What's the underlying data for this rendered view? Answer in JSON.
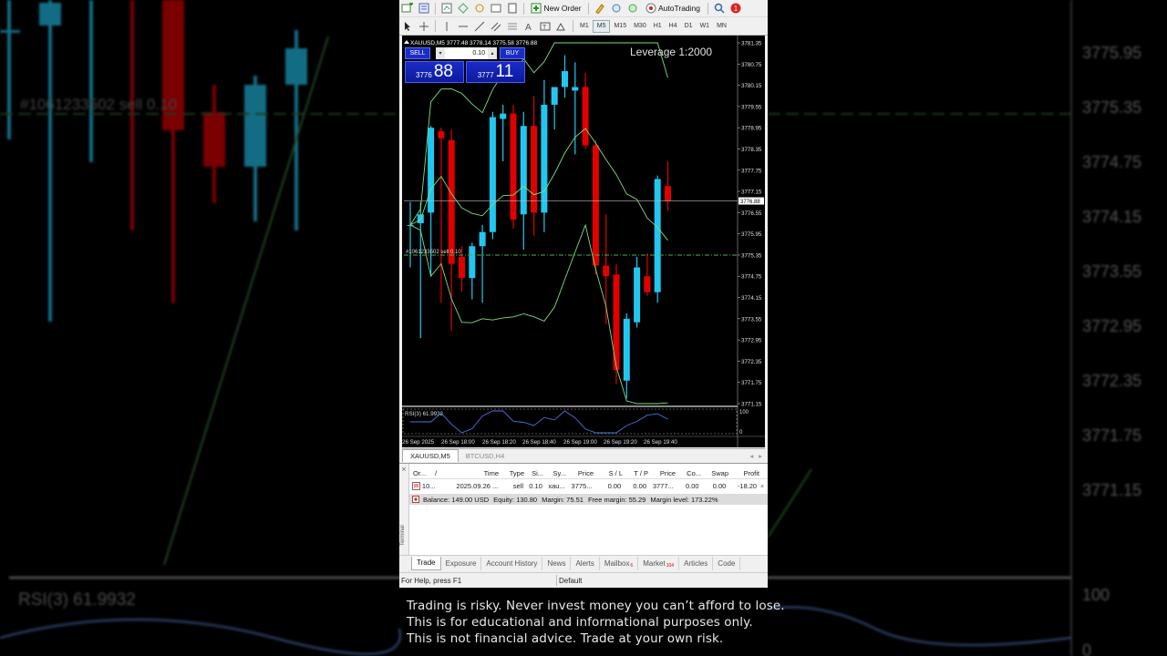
{
  "toolbar": {
    "new_order": "New Order",
    "autotrading": "AutoTrading",
    "notification_count": "1",
    "timeframes": [
      "M1",
      "M5",
      "M15",
      "M30",
      "H1",
      "H4",
      "D1",
      "W1",
      "MN"
    ],
    "active_timeframe": "M5"
  },
  "chart": {
    "header": "XAUUSD,M5  3777.48 3778.14 3775.58 3776.88",
    "leverage": "Leverage 1:2000",
    "position_label": "#1061233502 sell 0.10",
    "current_price_tag": "3776.88",
    "price_axis": [
      "3781.35",
      "3780.75",
      "3780.15",
      "3779.55",
      "3778.95",
      "3778.35",
      "3777.75",
      "3777.15",
      "3776.55",
      "3775.95",
      "3775.35",
      "3774.75",
      "3774.15",
      "3773.55",
      "3772.95",
      "3772.35",
      "3771.75",
      "3771.15"
    ],
    "time_axis": [
      "26 Sep 2025",
      "26 Sep 18:00",
      "26 Sep 18:20",
      "26 Sep 18:40",
      "26 Sep 19:00",
      "26 Sep 19:20",
      "26 Sep 19:40"
    ],
    "rsi_label": "RSI(3) 61.9932",
    "rsi_axis_top": "100",
    "rsi_axis_bottom": "0",
    "colors": {
      "bull": "#22c7f0",
      "bear": "#e00000",
      "bands": "#7fdf7f",
      "rsi": "#4a73d8",
      "sell_line": "#4caf50"
    }
  },
  "one_click": {
    "sell_label": "SELL",
    "buy_label": "BUY",
    "lot": "0.10",
    "sell_price_small": "3776",
    "sell_price_big": "88",
    "buy_price_small": "3777",
    "buy_price_big": "11"
  },
  "chart_tabs": [
    "XAUUSD,M5",
    "BTCUSD,H4"
  ],
  "terminal": {
    "label": "Terminal",
    "columns": [
      "Or...",
      "/",
      "Time",
      "Type",
      "Si...",
      "Sy...",
      "Price",
      "S / L",
      "T / P",
      "Price",
      "Co...",
      "Swap",
      "Profit"
    ],
    "row": {
      "order": "10...",
      "time": "2025.09.26 ...",
      "type": "sell",
      "size": "0.10",
      "symbol": "xau...",
      "price": "3775...",
      "sl": "0.00",
      "tp": "0.00",
      "cur_price": "3777...",
      "commission": "0.00",
      "swap": "0.00",
      "profit": "-18.20"
    },
    "balance": {
      "balance": "Balance: 149.00 USD",
      "equity": "Equity: 130.80",
      "margin": "Margin: 75.51",
      "free_margin": "Free margin: 55.29",
      "margin_level": "Margin level: 173.22%"
    },
    "tabs": [
      "Trade",
      "Exposure",
      "Account History",
      "News",
      "Alerts",
      "Mailbox",
      "Market",
      "Articles",
      "Code"
    ],
    "mailbox_badge": "6",
    "market_badge": "104"
  },
  "status": {
    "help": "For Help, press F1",
    "profile": "Default"
  },
  "disclaimer": [
    "Trading is risky. Never invest money you can’t afford to lose.",
    "This is for educational and informational purposes only.",
    "This is not financial advice. Trade at your own risk."
  ],
  "chart_data": {
    "type": "candlestick",
    "symbol": "XAUUSD",
    "timeframe": "M5",
    "candles": [
      {
        "o": 3776.2,
        "h": 3776.85,
        "l": 3775.0,
        "c": 3776.2
      },
      {
        "o": 3776.25,
        "h": 3776.85,
        "l": 3773.0,
        "c": 3776.5
      },
      {
        "o": 3776.55,
        "h": 3779.0,
        "l": 3774.75,
        "c": 3778.95
      },
      {
        "o": 3778.85,
        "h": 3778.95,
        "l": 3774.0,
        "c": 3778.65
      },
      {
        "o": 3778.6,
        "h": 3778.9,
        "l": 3773.2,
        "c": 3775.1
      },
      {
        "o": 3775.3,
        "h": 3775.6,
        "l": 3774.3,
        "c": 3774.7
      },
      {
        "o": 3774.7,
        "h": 3775.7,
        "l": 3774.1,
        "c": 3775.6
      },
      {
        "o": 3775.6,
        "h": 3776.2,
        "l": 3774.0,
        "c": 3776.0
      },
      {
        "o": 3776.0,
        "h": 3779.4,
        "l": 3775.8,
        "c": 3779.25
      },
      {
        "o": 3779.2,
        "h": 3779.6,
        "l": 3778.0,
        "c": 3779.35
      },
      {
        "o": 3779.35,
        "h": 3779.6,
        "l": 3776.1,
        "c": 3776.35
      },
      {
        "o": 3776.5,
        "h": 3779.4,
        "l": 3775.5,
        "c": 3779.0
      },
      {
        "o": 3779.0,
        "h": 3779.85,
        "l": 3775.9,
        "c": 3776.55
      },
      {
        "o": 3776.55,
        "h": 3780.3,
        "l": 3776.0,
        "c": 3779.6
      },
      {
        "o": 3779.6,
        "h": 3780.0,
        "l": 3778.9,
        "c": 3780.1
      },
      {
        "o": 3780.1,
        "h": 3781.0,
        "l": 3779.8,
        "c": 3780.55
      },
      {
        "o": 3780.0,
        "h": 3780.8,
        "l": 3778.2,
        "c": 3780.1
      },
      {
        "o": 3780.1,
        "h": 3780.5,
        "l": 3778.35,
        "c": 3778.45
      },
      {
        "o": 3778.45,
        "h": 3778.6,
        "l": 3774.8,
        "c": 3775.05
      },
      {
        "o": 3775.05,
        "h": 3776.5,
        "l": 3773.4,
        "c": 3774.75
      },
      {
        "o": 3774.8,
        "h": 3775.1,
        "l": 3771.7,
        "c": 3772.1
      },
      {
        "o": 3771.8,
        "h": 3773.7,
        "l": 3771.3,
        "c": 3773.55
      },
      {
        "o": 3773.45,
        "h": 3775.3,
        "l": 3773.3,
        "c": 3775.0
      },
      {
        "o": 3774.75,
        "h": 3775.4,
        "l": 3774.2,
        "c": 3774.3
      },
      {
        "o": 3774.3,
        "h": 3777.6,
        "l": 3774.0,
        "c": 3777.5
      },
      {
        "o": 3777.3,
        "h": 3778.0,
        "l": 3776.6,
        "c": 3776.88
      }
    ],
    "sell_entry": 3775.35,
    "current_bid": 3776.88,
    "ylim": [
      3771.15,
      3781.35
    ],
    "rsi_value": 61.9932,
    "rsi_range": [
      0,
      100
    ]
  }
}
